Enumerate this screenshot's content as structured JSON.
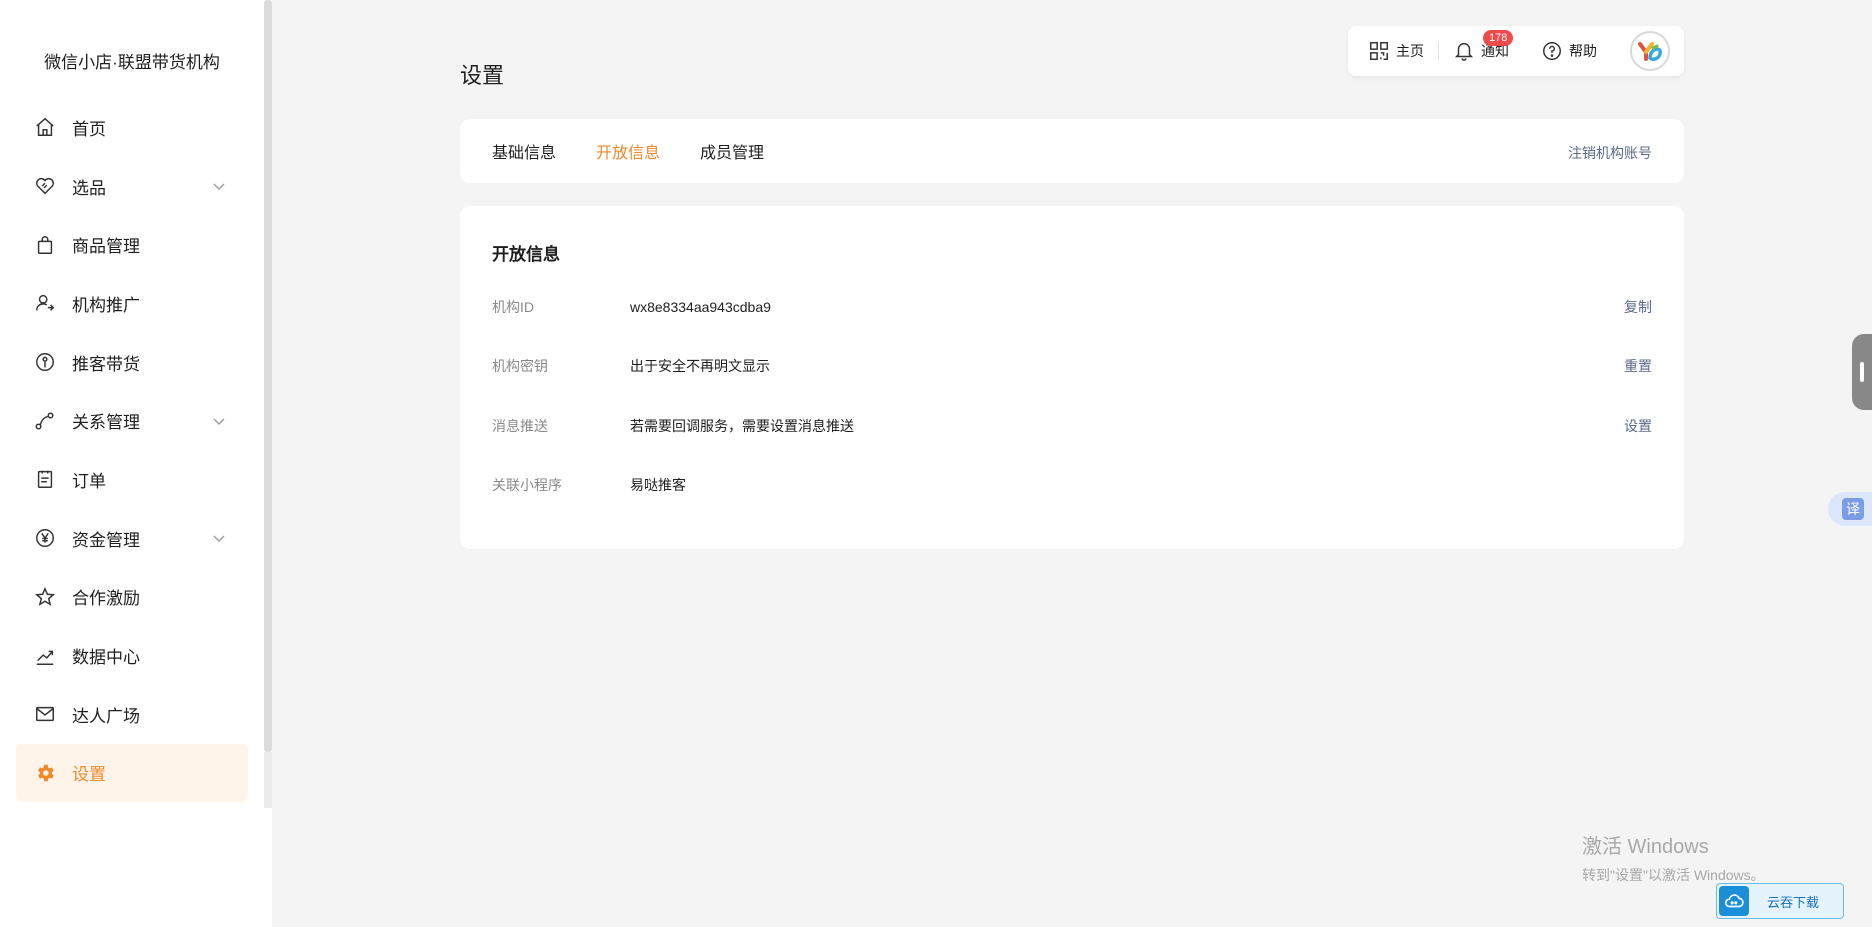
{
  "sidebar": {
    "brand": "微信小店·联盟带货机构",
    "items": [
      {
        "label": "首页",
        "icon": "home-icon"
      },
      {
        "label": "选品",
        "icon": "heart-tag-icon",
        "has_children": true
      },
      {
        "label": "商品管理",
        "icon": "bag-icon"
      },
      {
        "label": "机构推广",
        "icon": "user-share-icon"
      },
      {
        "label": "推客带货",
        "icon": "person-badge-icon"
      },
      {
        "label": "关系管理",
        "icon": "relation-icon",
        "has_children": true
      },
      {
        "label": "订单",
        "icon": "clipboard-icon"
      },
      {
        "label": "资金管理",
        "icon": "yen-icon",
        "has_children": true
      },
      {
        "label": "合作激励",
        "icon": "star-icon"
      },
      {
        "label": "数据中心",
        "icon": "trend-icon"
      },
      {
        "label": "达人广场",
        "icon": "mail-icon"
      },
      {
        "label": "设置",
        "icon": "gear-icon",
        "active": true
      }
    ]
  },
  "topbar": {
    "home_label": "主页",
    "notify_label": "通知",
    "notify_count": "178",
    "help_label": "帮助"
  },
  "page": {
    "title": "设置",
    "tabs": [
      {
        "label": "基础信息"
      },
      {
        "label": "开放信息",
        "active": true
      },
      {
        "label": "成员管理"
      }
    ],
    "tab_right_action": "注销机构账号"
  },
  "open_info": {
    "title": "开放信息",
    "rows": [
      {
        "key": "机构ID",
        "value": "wx8e8334aa943cdba9",
        "action": "复制"
      },
      {
        "key": "机构密钥",
        "value": "出于安全不再明文显示",
        "action": "重置"
      },
      {
        "key": "消息推送",
        "value": "若需要回调服务，需要设置消息推送",
        "action": "设置"
      },
      {
        "key": "关联小程序",
        "value": "易哒推客",
        "action": ""
      }
    ]
  },
  "overlay": {
    "translate_label": "译",
    "watermark_line1": "激活 Windows",
    "watermark_line2": "转到\"设置\"以激活 Windows。",
    "cloud_download_label": "云吞下载"
  },
  "colors": {
    "accent": "#ee8a2a",
    "active_bg": "#fff4ea",
    "link": "#5b6b8c",
    "badge": "#f04a4a"
  }
}
